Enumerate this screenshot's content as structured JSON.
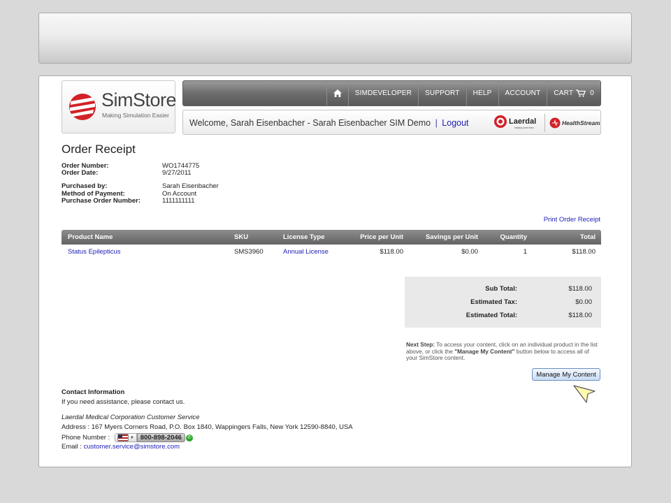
{
  "header": {
    "logo_name": "SimStore",
    "logo_tagline": "Making Simulation Easier",
    "nav": [
      {
        "label": "SIMDEVELOPER"
      },
      {
        "label": "SUPPORT"
      },
      {
        "label": "HELP"
      },
      {
        "label": "ACCOUNT"
      }
    ],
    "cart_label": "CART",
    "cart_count": "0",
    "welcome_text": "Welcome, Sarah Eisenbacher - Sarah Eisenbacher SIM Demo",
    "separator": "|",
    "logout_label": "Logout",
    "partner_1": "Laerdal",
    "partner_1_tag": "helping save lives",
    "partner_2": "HealthStream"
  },
  "receipt": {
    "title": "Order Receipt",
    "order_number_label": "Order Number:",
    "order_number": "WO1744775",
    "order_date_label": "Order Date:",
    "order_date": "9/27/2011",
    "purchased_by_label": "Purchased by:",
    "purchased_by": "Sarah Eisenbacher",
    "payment_label": "Method of Payment:",
    "payment": "On Account",
    "po_label": "Purchase Order Number:",
    "po": "1111111111",
    "print_label": "Print Order Receipt"
  },
  "table": {
    "columns": [
      "Product Name",
      "SKU",
      "License Type",
      "Price per Unit",
      "Savings per Unit",
      "Quantity",
      "Total"
    ],
    "rows": [
      {
        "product": "Status Epilepticus",
        "sku": "SMS3960",
        "license": "Annual License",
        "price": "$118.00",
        "savings": "$0.00",
        "quantity": "1",
        "total": "$118.00"
      }
    ]
  },
  "totals": {
    "subtotal_label": "Sub Total:",
    "subtotal": "$118.00",
    "tax_label": "Estimated Tax:",
    "tax": "$0.00",
    "total_label": "Estimated Total:",
    "total": "$118.00"
  },
  "next_step": {
    "label": "Next Step:",
    "text_1": " To access your content, click on an individual product in the list above, or click the ",
    "highlight": "\"Manage My Content\"",
    "text_2": " button below to access all of your SimStore content.",
    "button_label": "Manage My Content"
  },
  "contact": {
    "title": "Contact Information",
    "intro": "If you need assistance, please contact us.",
    "company": "Laerdal Medical Corporation Customer Service",
    "address": "Address : 167 Myers Corners Road, P.O. Box 1840, Wappingers Falls, New York 12590-8840, USA",
    "phone_label": "Phone Number :",
    "phone": "800-898-2046",
    "email_label": "Email :",
    "email": "customer.service@simstore.com"
  },
  "colors": {
    "link": "#2020b8",
    "brand_red": "#d22128",
    "nav_gray": "#6a6a6a"
  }
}
